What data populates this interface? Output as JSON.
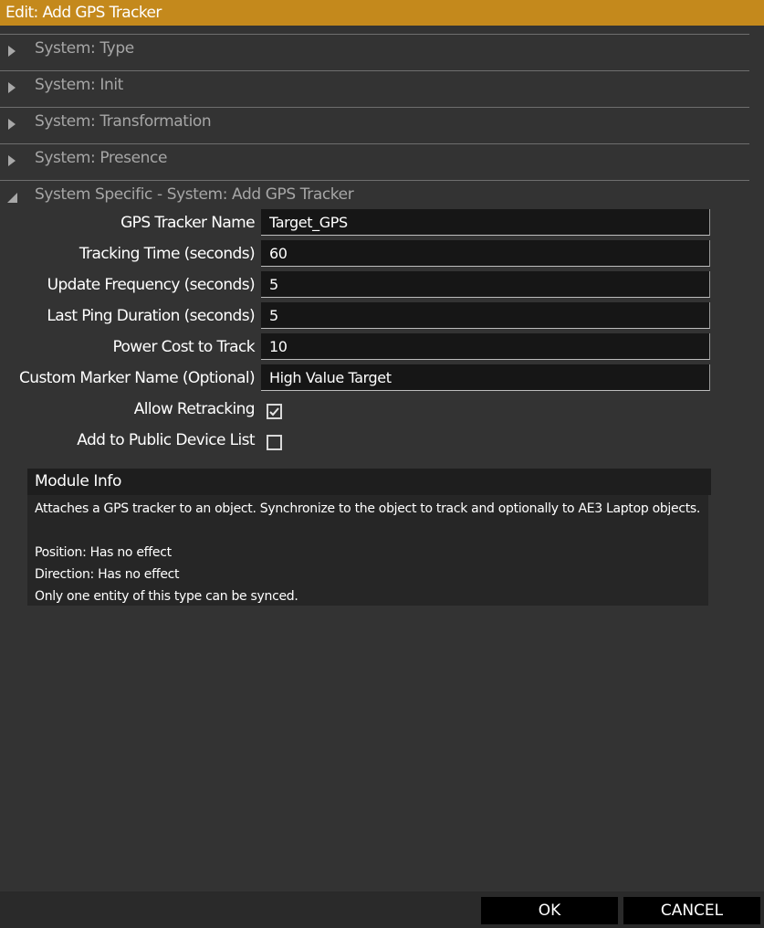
{
  "window": {
    "title": "Edit: Add GPS Tracker"
  },
  "sections": [
    {
      "label": "System: Type",
      "expanded": false
    },
    {
      "label": "System: Init",
      "expanded": false
    },
    {
      "label": "System: Transformation",
      "expanded": false
    },
    {
      "label": "System: Presence",
      "expanded": false
    },
    {
      "label": "System Specific - System: Add GPS Tracker",
      "expanded": true
    }
  ],
  "fields": {
    "tracker_name": {
      "label": "GPS Tracker Name",
      "value": "Target_GPS"
    },
    "tracking_time": {
      "label": "Tracking Time (seconds)",
      "value": "60"
    },
    "update_frequency": {
      "label": "Update Frequency (seconds)",
      "value": "5"
    },
    "last_ping_duration": {
      "label": "Last Ping Duration (seconds)",
      "value": "5"
    },
    "power_cost": {
      "label": "Power Cost to Track",
      "value": "10"
    },
    "custom_marker_name": {
      "label": "Custom Marker Name (Optional)",
      "value": "High Value Target"
    },
    "allow_retracking": {
      "label": "Allow Retracking",
      "checked": true
    },
    "public_device_list": {
      "label": "Add to Public Device List",
      "checked": false
    }
  },
  "module_info": {
    "title": "Module Info",
    "lines": [
      "Attaches a GPS tracker to an object. Synchronize to the object to track and optionally to AE3 Laptop objects.",
      "",
      "Position: Has no effect",
      "Direction: Has no effect",
      "Only one entity of this type can be synced."
    ]
  },
  "buttons": {
    "ok": "OK",
    "cancel": "CANCEL"
  },
  "colors": {
    "title_bar": "#c4891c",
    "background": "#333333",
    "input_background": "#161616"
  }
}
